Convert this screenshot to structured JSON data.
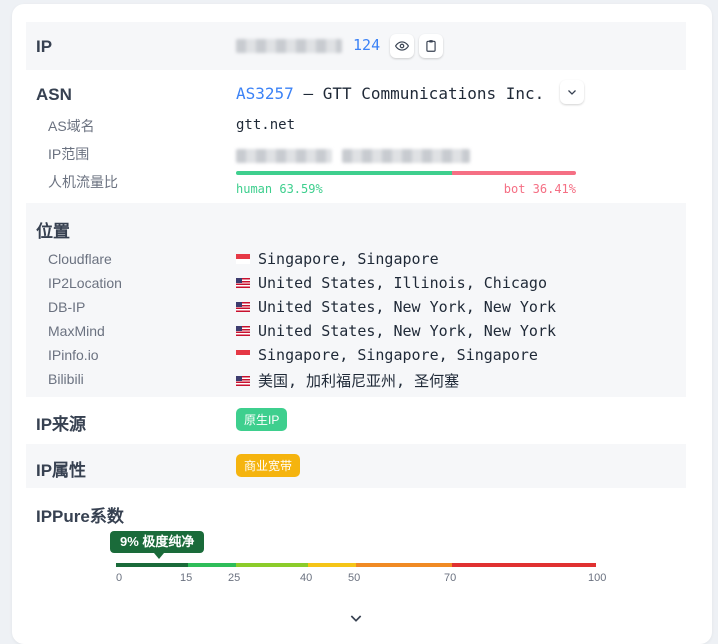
{
  "ip": {
    "label": "IP",
    "masked_suffix": "124"
  },
  "asn": {
    "label": "ASN",
    "number": "AS3257",
    "separator": "—",
    "org": "GTT Communications Inc.",
    "domain_label": "AS域名",
    "domain_value": "gtt.net",
    "range_label": "IP范围",
    "traffic_label": "人机流量比",
    "human_text": "human 63.59%",
    "bot_text": "bot 36.41%",
    "human_ratio": 0.6359,
    "human_color": "#3ecf8e",
    "bot_color": "#f56f84"
  },
  "location": {
    "label": "位置",
    "rows": [
      {
        "source": "Cloudflare",
        "flag": "sg",
        "value": "Singapore, Singapore"
      },
      {
        "source": "IP2Location",
        "flag": "us",
        "value": "United States, Illinois, Chicago"
      },
      {
        "source": "DB-IP",
        "flag": "us",
        "value": "United States, New York, New York"
      },
      {
        "source": "MaxMind",
        "flag": "us",
        "value": "United States, New York, New York"
      },
      {
        "source": "IPinfo.io",
        "flag": "sg",
        "value": "Singapore, Singapore, Singapore"
      },
      {
        "source": "Bilibili",
        "flag": "us",
        "value": "美国, 加利福尼亚州, 圣何塞"
      }
    ]
  },
  "ip_source": {
    "label": "IP来源",
    "badge": "原生IP",
    "color": "#3ecf8e"
  },
  "ip_attr": {
    "label": "IP属性",
    "badge": "商业宽带",
    "color": "#f5b40f"
  },
  "ippure": {
    "label": "IPPure系数",
    "score_text": "9% 极度纯净",
    "score": 9,
    "score_color": "#1a6b3a",
    "ticks": [
      "0",
      "15",
      "25",
      "40",
      "50",
      "70",
      "100"
    ],
    "segments": [
      {
        "from": 0,
        "to": 15,
        "color": "#1a6b3a"
      },
      {
        "from": 15,
        "to": 25,
        "color": "#2ebd59"
      },
      {
        "from": 25,
        "to": 40,
        "color": "#8ccc2a"
      },
      {
        "from": 40,
        "to": 50,
        "color": "#f5c518"
      },
      {
        "from": 50,
        "to": 70,
        "color": "#f08a24"
      },
      {
        "from": 70,
        "to": 100,
        "color": "#e03131"
      }
    ]
  },
  "icons": {
    "eye": "eye-icon",
    "copy": "clipboard-icon",
    "expand": "chevron-down-icon",
    "more": "chevron-down-icon"
  }
}
